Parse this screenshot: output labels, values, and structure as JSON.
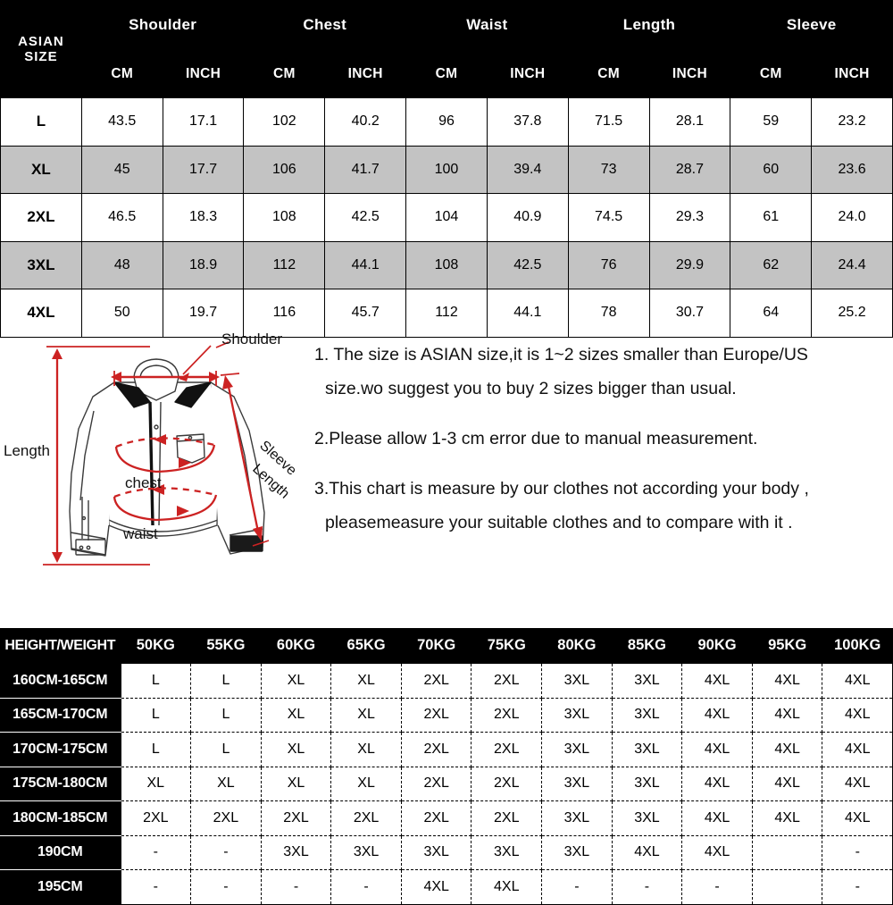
{
  "size_table": {
    "corner_label": "ASIAN  SIZE",
    "groups": [
      "Shoulder",
      "Chest",
      "Waist",
      "Length",
      "Sleeve"
    ],
    "units": [
      "CM",
      "INCH"
    ],
    "rows": [
      {
        "size": "L",
        "values": [
          "43.5",
          "17.1",
          "102",
          "40.2",
          "96",
          "37.8",
          "71.5",
          "28.1",
          "59",
          "23.2"
        ],
        "shaded": false
      },
      {
        "size": "XL",
        "values": [
          "45",
          "17.7",
          "106",
          "41.7",
          "100",
          "39.4",
          "73",
          "28.7",
          "60",
          "23.6"
        ],
        "shaded": true
      },
      {
        "size": "2XL",
        "values": [
          "46.5",
          "18.3",
          "108",
          "42.5",
          "104",
          "40.9",
          "74.5",
          "29.3",
          "61",
          "24.0"
        ],
        "shaded": false
      },
      {
        "size": "3XL",
        "values": [
          "48",
          "18.9",
          "112",
          "44.1",
          "108",
          "42.5",
          "76",
          "29.9",
          "62",
          "24.4"
        ],
        "shaded": true
      },
      {
        "size": "4XL",
        "values": [
          "50",
          "19.7",
          "116",
          "45.7",
          "112",
          "44.1",
          "78",
          "30.7",
          "64",
          "25.2"
        ],
        "shaded": false
      }
    ]
  },
  "diagram": {
    "labels": {
      "shoulder": "Shoulder",
      "sleeve_line1": "Sleeve",
      "sleeve_line2": "Length",
      "length": "Length",
      "chest": "chest",
      "waist": "waist"
    },
    "accent_color": "#cc2222",
    "outline_color": "#3a3a3a"
  },
  "notes": {
    "note1_line1": "1. The size is ASIAN size,it is 1~2 sizes smaller than Europe/US",
    "note1_line2": "size.wo suggest you to buy 2 sizes bigger than usual.",
    "note2": "2.Please allow 1-3 cm error due to manual measurement.",
    "note3_line1": "3.This chart is measure by our clothes not according your body ,",
    "note3_line2": "pleasemeasure your suitable clothes and to compare with it ."
  },
  "fit_table": {
    "corner_label": "HEIGHT/WEIGHT",
    "weights": [
      "50KG",
      "55KG",
      "60KG",
      "65KG",
      "70KG",
      "75KG",
      "80KG",
      "85KG",
      "90KG",
      "95KG",
      "100KG"
    ],
    "rows": [
      {
        "height": "160CM-165CM",
        "sizes": [
          "L",
          "L",
          "XL",
          "XL",
          "2XL",
          "2XL",
          "3XL",
          "3XL",
          "4XL",
          "4XL",
          "4XL"
        ]
      },
      {
        "height": "165CM-170CM",
        "sizes": [
          "L",
          "L",
          "XL",
          "XL",
          "2XL",
          "2XL",
          "3XL",
          "3XL",
          "4XL",
          "4XL",
          "4XL"
        ]
      },
      {
        "height": "170CM-175CM",
        "sizes": [
          "L",
          "L",
          "XL",
          "XL",
          "2XL",
          "2XL",
          "3XL",
          "3XL",
          "4XL",
          "4XL",
          "4XL"
        ]
      },
      {
        "height": "175CM-180CM",
        "sizes": [
          "XL",
          "XL",
          "XL",
          "XL",
          "2XL",
          "2XL",
          "3XL",
          "3XL",
          "4XL",
          "4XL",
          "4XL"
        ]
      },
      {
        "height": "180CM-185CM",
        "sizes": [
          "2XL",
          "2XL",
          "2XL",
          "2XL",
          "2XL",
          "2XL",
          "3XL",
          "3XL",
          "4XL",
          "4XL",
          "4XL"
        ]
      },
      {
        "height": "190CM",
        "sizes": [
          "-",
          "-",
          "3XL",
          "3XL",
          "3XL",
          "3XL",
          "3XL",
          "4XL",
          "4XL",
          "",
          "-"
        ]
      },
      {
        "height": "195CM",
        "sizes": [
          "-",
          "-",
          "-",
          "-",
          "4XL",
          "4XL",
          "-",
          "-",
          "-",
          "",
          "-"
        ]
      }
    ]
  },
  "colors": {
    "header_bg": "#000000",
    "header_fg": "#ffffff",
    "shaded_row": "#c3c3c3",
    "accent": "#cc2222"
  }
}
